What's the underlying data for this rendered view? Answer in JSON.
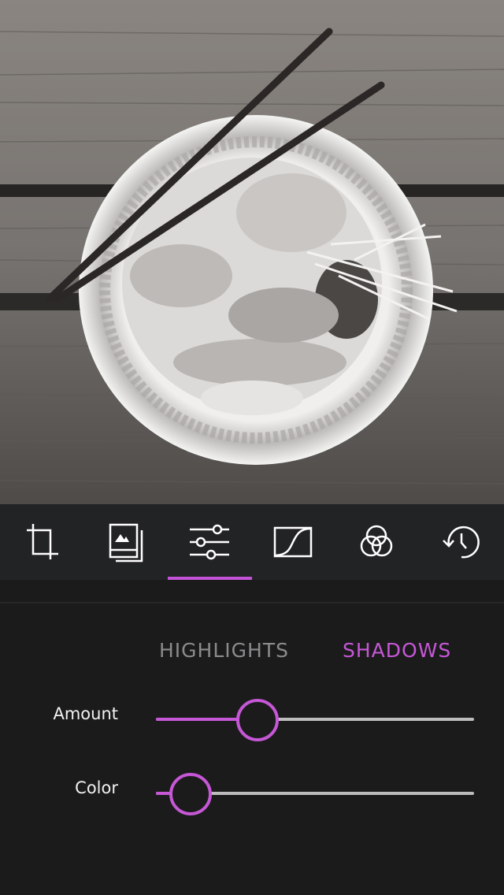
{
  "photo": {
    "description": "Black and white overhead photo of a sashimi bowl with chopsticks on a wooden table",
    "tone": "monochrome"
  },
  "toolbar": {
    "tools": [
      {
        "id": "crop",
        "icon": "crop-icon",
        "label": "Crop"
      },
      {
        "id": "filters",
        "icon": "photo-stack-icon",
        "label": "Filters"
      },
      {
        "id": "adjust",
        "icon": "sliders-icon",
        "label": "Adjust"
      },
      {
        "id": "curves",
        "icon": "curves-icon",
        "label": "Curves"
      },
      {
        "id": "color",
        "icon": "color-circles-icon",
        "label": "Color"
      },
      {
        "id": "history",
        "icon": "history-icon",
        "label": "History"
      }
    ],
    "active_tool": "adjust"
  },
  "tabs": {
    "items": [
      "HIGHLIGHTS",
      "SHADOWS"
    ],
    "active": "SHADOWS"
  },
  "controls": {
    "amount": {
      "label": "Amount",
      "value": 0.32
    },
    "color": {
      "label": "Color",
      "value": 0.11
    }
  },
  "colors": {
    "accent": "#c657d6",
    "background": "#1b1b1c",
    "toolbar": "#222325",
    "track": "#bdbdbd",
    "inactive_tab": "#8b8b8c"
  }
}
